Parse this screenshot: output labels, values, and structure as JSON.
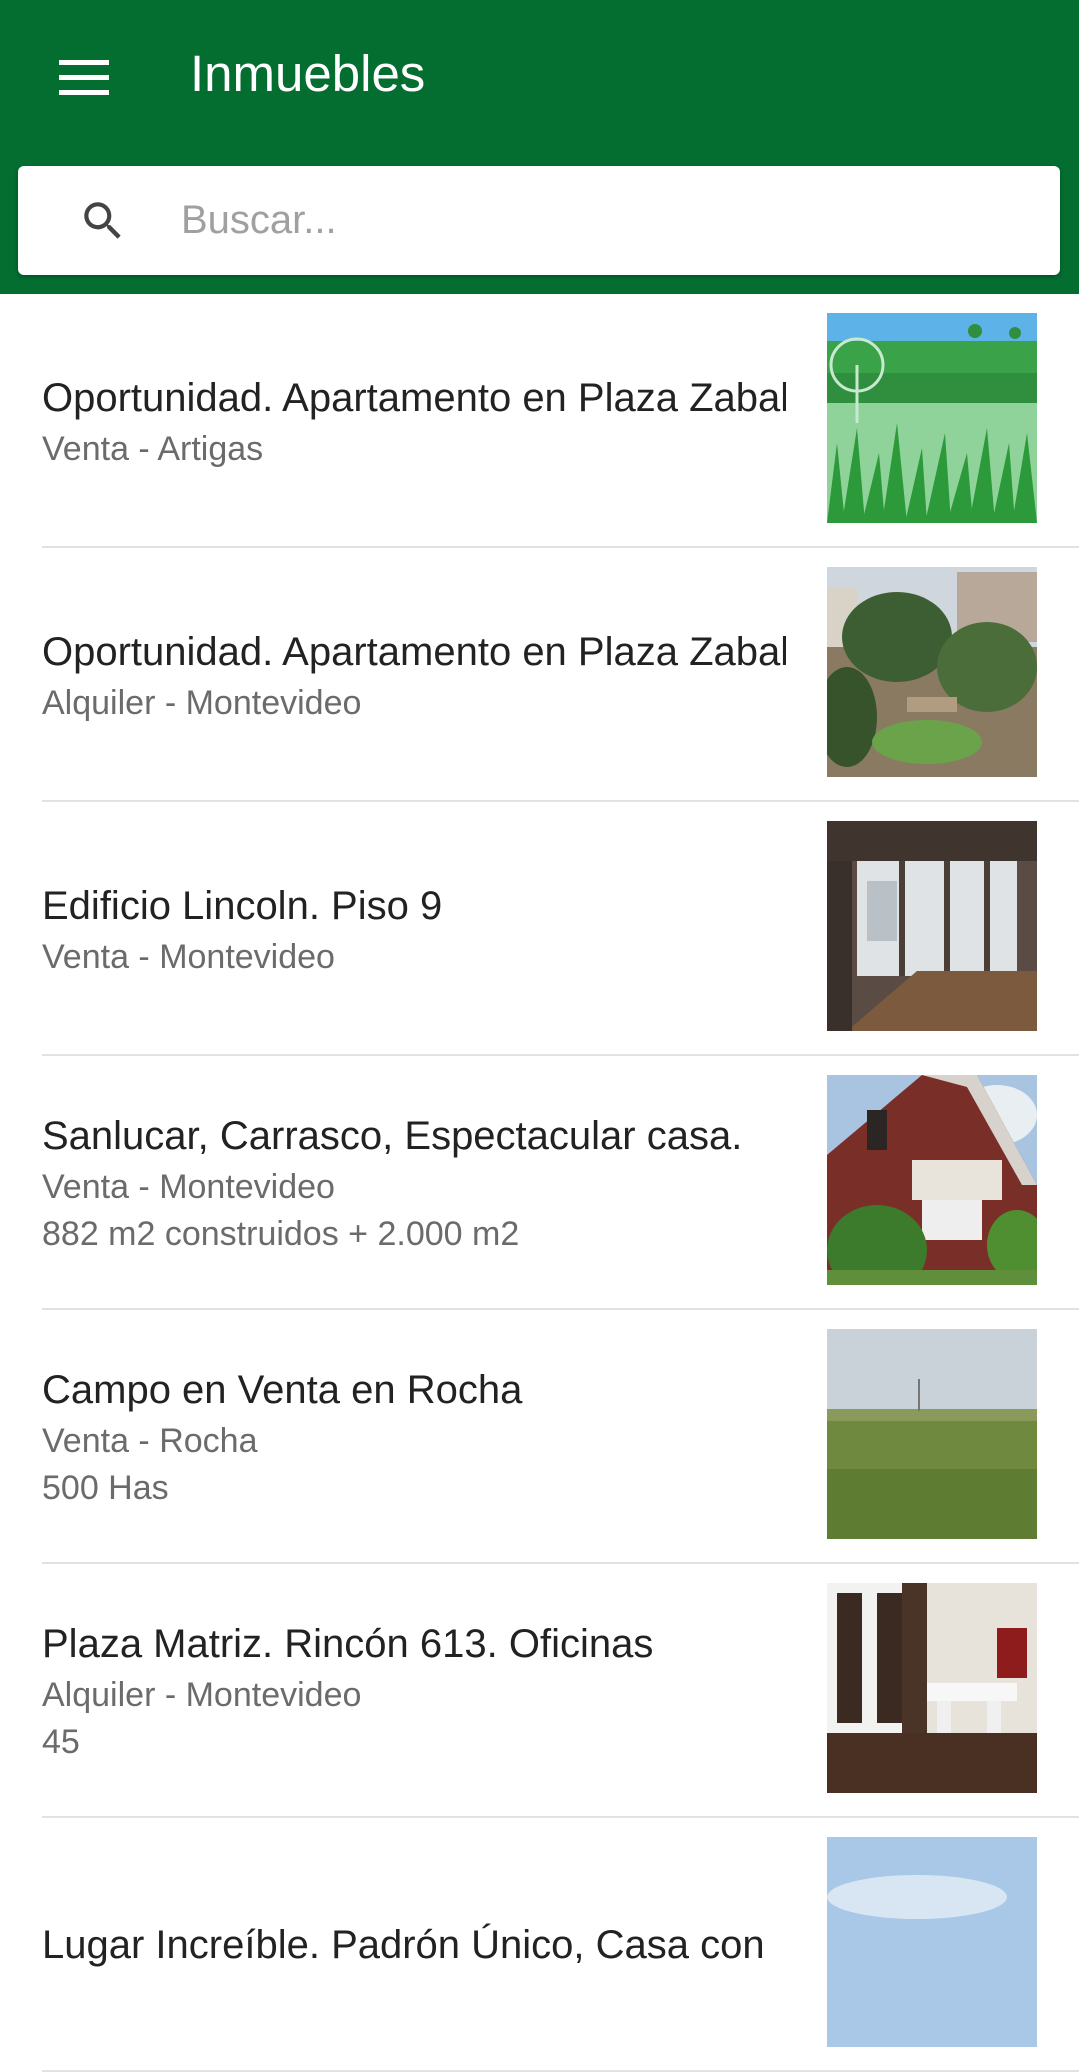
{
  "appbar": {
    "title": "Inmuebles",
    "menu_icon": "hamburger-menu-icon",
    "color": "#046D30"
  },
  "search": {
    "placeholder": "Buscar...",
    "value": "",
    "icon": "search-icon"
  },
  "listings": [
    {
      "title": "Oportunidad. Apartamento en Plaza Zabala",
      "subtitle": "Venta - Artigas",
      "detail": "",
      "image": "windmill-field-illustration"
    },
    {
      "title": "Oportunidad. Apartamento en Plaza Zabala",
      "subtitle": "Alquiler - Montevideo",
      "detail": "",
      "image": "plaza-park-photo"
    },
    {
      "title": "Edificio Lincoln. Piso 9",
      "subtitle": "Venta - Montevideo",
      "detail": "",
      "image": "empty-apartment-interior-photo"
    },
    {
      "title": "Sanlucar, Carrasco, Espectacular casa.",
      "subtitle": "Venta - Montevideo",
      "detail": "882 m2 construidos + 2.000 m2",
      "image": "brick-house-photo"
    },
    {
      "title": "Campo en Venta en Rocha",
      "subtitle": "Venta - Rocha",
      "detail": "500 Has",
      "image": "open-field-photo"
    },
    {
      "title": "Plaza Matriz. Rincón 613. Oficinas",
      "subtitle": "Alquiler - Montevideo",
      "detail": "45",
      "image": "office-interior-photo"
    },
    {
      "title": "Lugar Increíble. Padrón Único, Casa con",
      "subtitle": "",
      "detail": "",
      "image": "sky-photo"
    }
  ]
}
